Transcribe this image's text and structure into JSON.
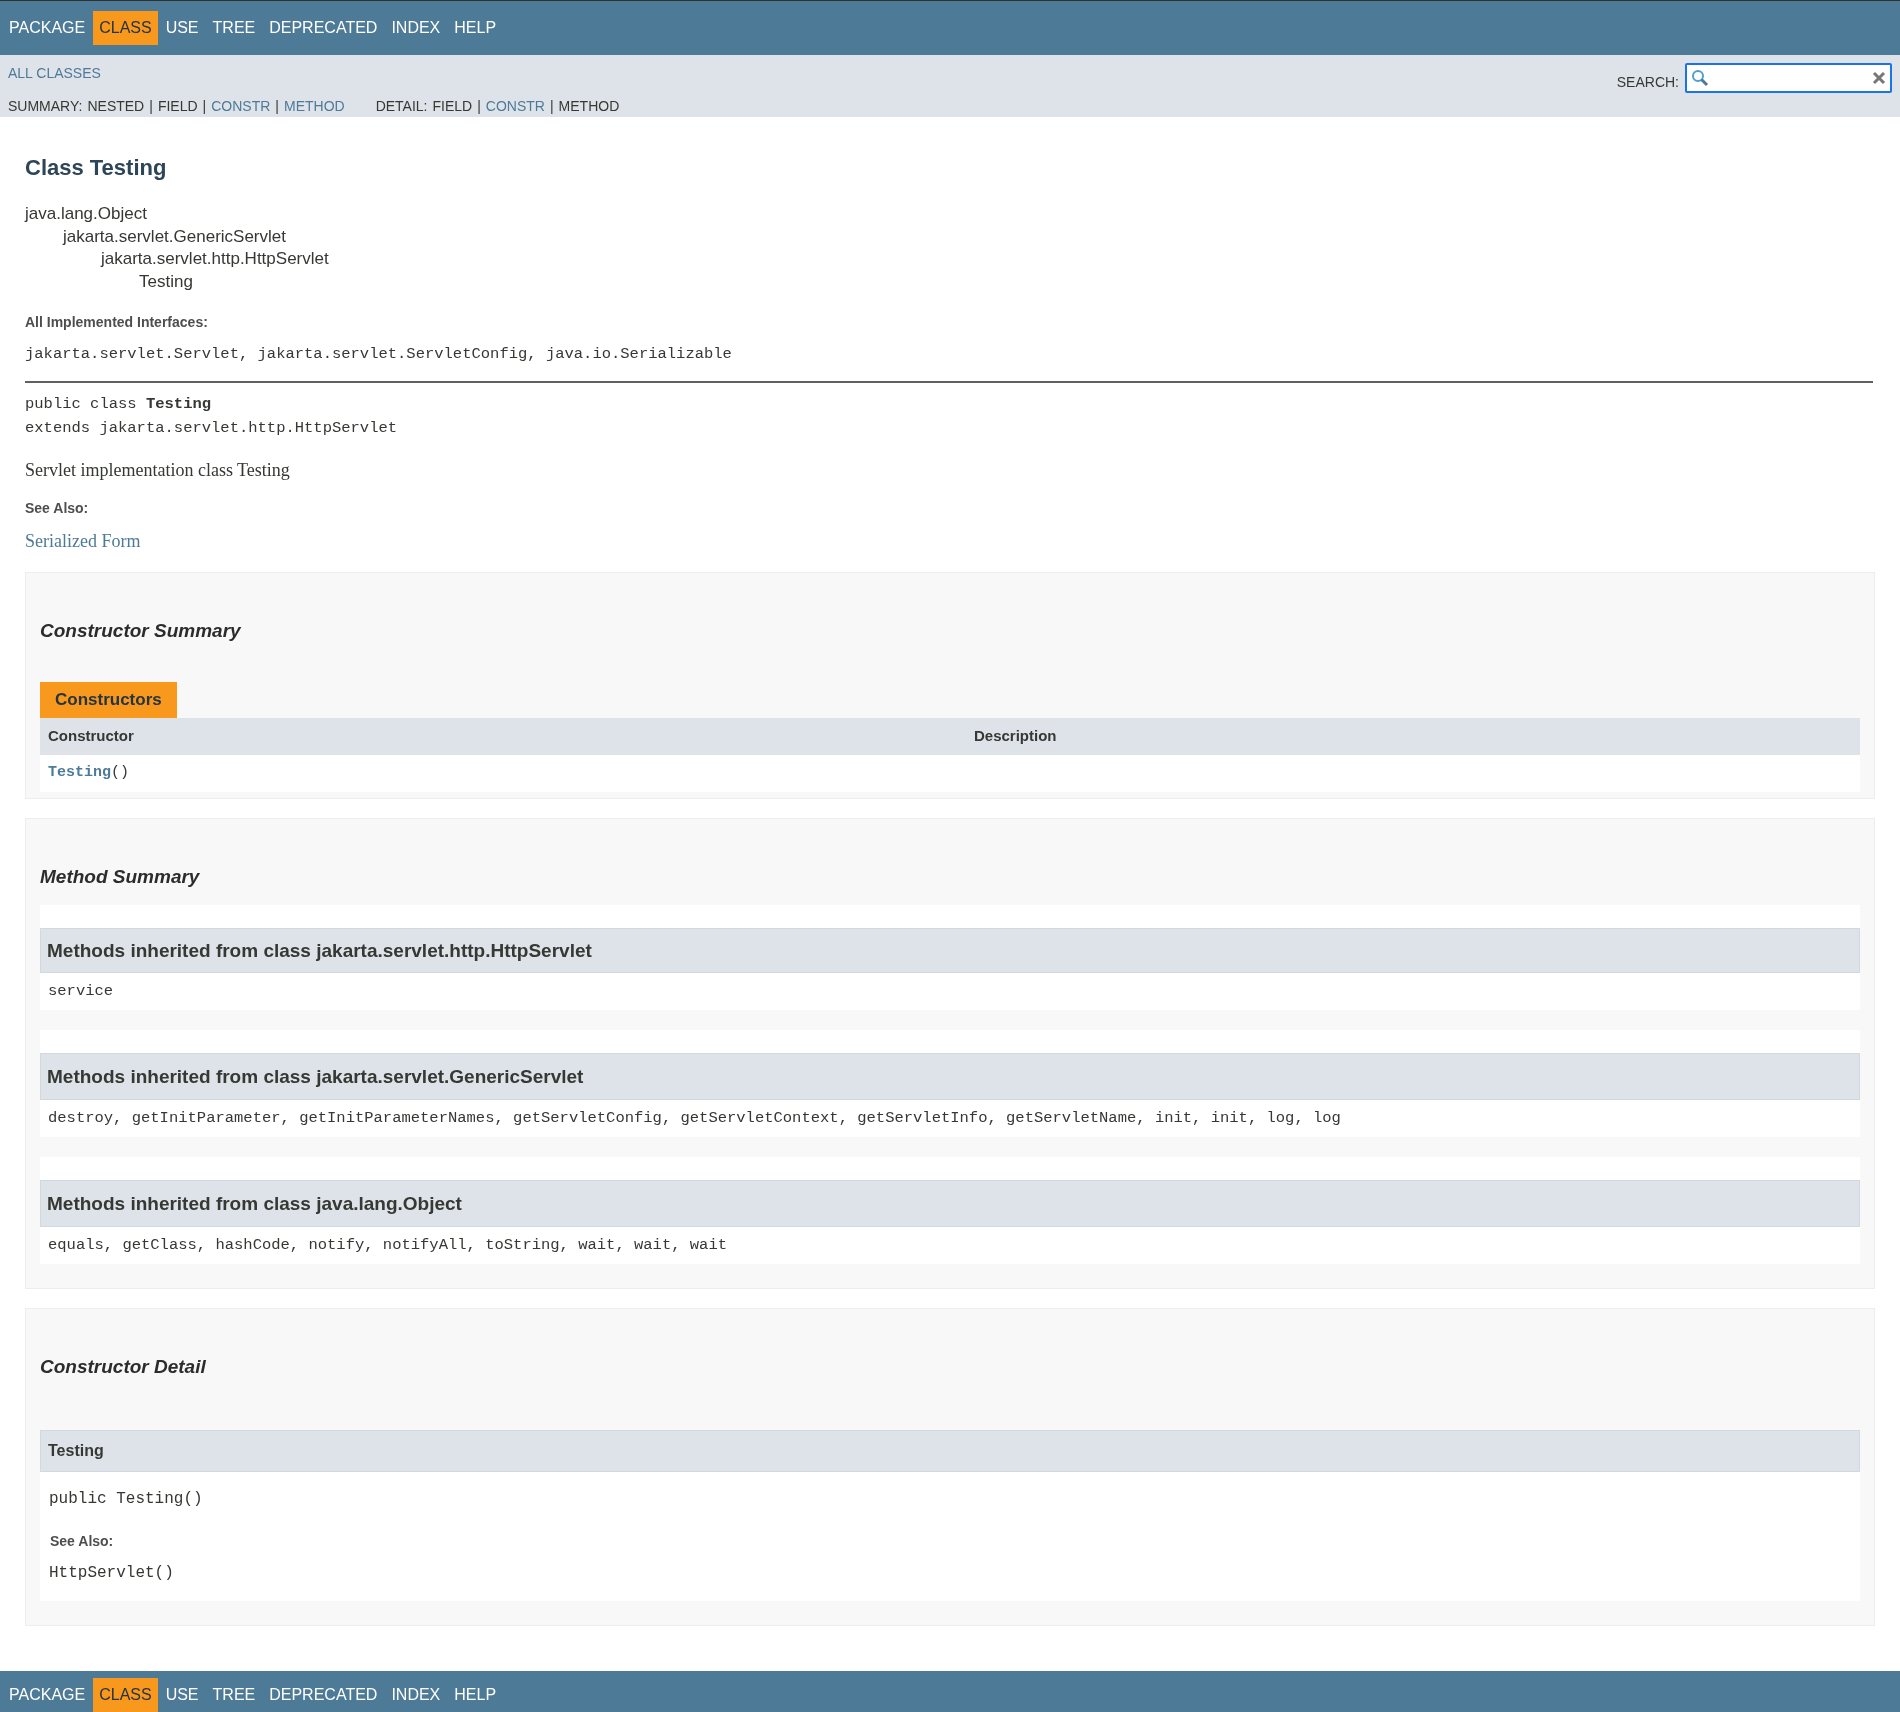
{
  "top_nav": [
    {
      "label": "PACKAGE",
      "selected": false
    },
    {
      "label": "CLASS",
      "selected": true
    },
    {
      "label": "USE",
      "selected": false
    },
    {
      "label": "TREE",
      "selected": false
    },
    {
      "label": "DEPRECATED",
      "selected": false
    },
    {
      "label": "INDEX",
      "selected": false
    },
    {
      "label": "HELP",
      "selected": false
    }
  ],
  "sub_nav": {
    "all_classes": "ALL CLASSES",
    "search_label": "SEARCH:",
    "summary": {
      "label": "SUMMARY:",
      "items": [
        {
          "label": "NESTED",
          "link": false
        },
        {
          "label": "FIELD",
          "link": false
        },
        {
          "label": "CONSTR",
          "link": true
        },
        {
          "label": "METHOD",
          "link": true
        }
      ]
    },
    "detail": {
      "label": "DETAIL:",
      "items": [
        {
          "label": "FIELD",
          "link": false
        },
        {
          "label": "CONSTR",
          "link": true
        },
        {
          "label": "METHOD",
          "link": false
        }
      ]
    },
    "separator": "|"
  },
  "header": {
    "title": "Class Testing",
    "inheritance": [
      {
        "name": "java.lang.Object",
        "children": [
          {
            "name": "jakarta.servlet.GenericServlet",
            "children": [
              {
                "name": "jakarta.servlet.http.HttpServlet",
                "children": [
                  {
                    "name": "Testing"
                  }
                ]
              }
            ]
          }
        ]
      }
    ]
  },
  "description": {
    "interfaces_label": "All Implemented Interfaces:",
    "interfaces": "jakarta.servlet.Servlet, jakarta.servlet.ServletConfig, java.io.Serializable",
    "signature": [
      "public class **Testing**",
      "extends jakarta.servlet.http.HttpServlet"
    ],
    "text": "Servlet implementation class Testing",
    "see_also_label": "See Also:",
    "see_also_link": "Serialized Form"
  },
  "constructor_summary": {
    "heading": "Constructor Summary",
    "caption": "Constructors",
    "columns": [
      "Constructor",
      "Description"
    ],
    "rows": [
      {
        "name": "Testing",
        "params": "()"
      }
    ]
  },
  "method_summary": {
    "heading": "Method Summary",
    "inherited": [
      {
        "title": "Methods inherited from class jakarta.servlet.http.HttpServlet",
        "methods": "service"
      },
      {
        "title": "Methods inherited from class jakarta.servlet.GenericServlet",
        "methods": "destroy, getInitParameter, getInitParameterNames, getServletConfig, getServletContext, getServletInfo, getServletName, init, init, log, log"
      },
      {
        "title": "Methods inherited from class java.lang.Object",
        "methods": "equals, getClass, hashCode, notify, notifyAll, toString, wait, wait, wait"
      }
    ]
  },
  "constructor_detail": {
    "heading": "Constructor Detail",
    "items": [
      {
        "name": "Testing",
        "signature": "public Testing()",
        "see_also_label": "See Also:",
        "see_also": "HttpServlet()"
      }
    ]
  },
  "bottom_nav": [
    {
      "label": "PACKAGE",
      "selected": false
    },
    {
      "label": "CLASS",
      "selected": true
    },
    {
      "label": "USE",
      "selected": false
    },
    {
      "label": "TREE",
      "selected": false
    },
    {
      "label": "DEPRECATED",
      "selected": false
    },
    {
      "label": "INDEX",
      "selected": false
    },
    {
      "label": "HELP",
      "selected": false
    }
  ]
}
